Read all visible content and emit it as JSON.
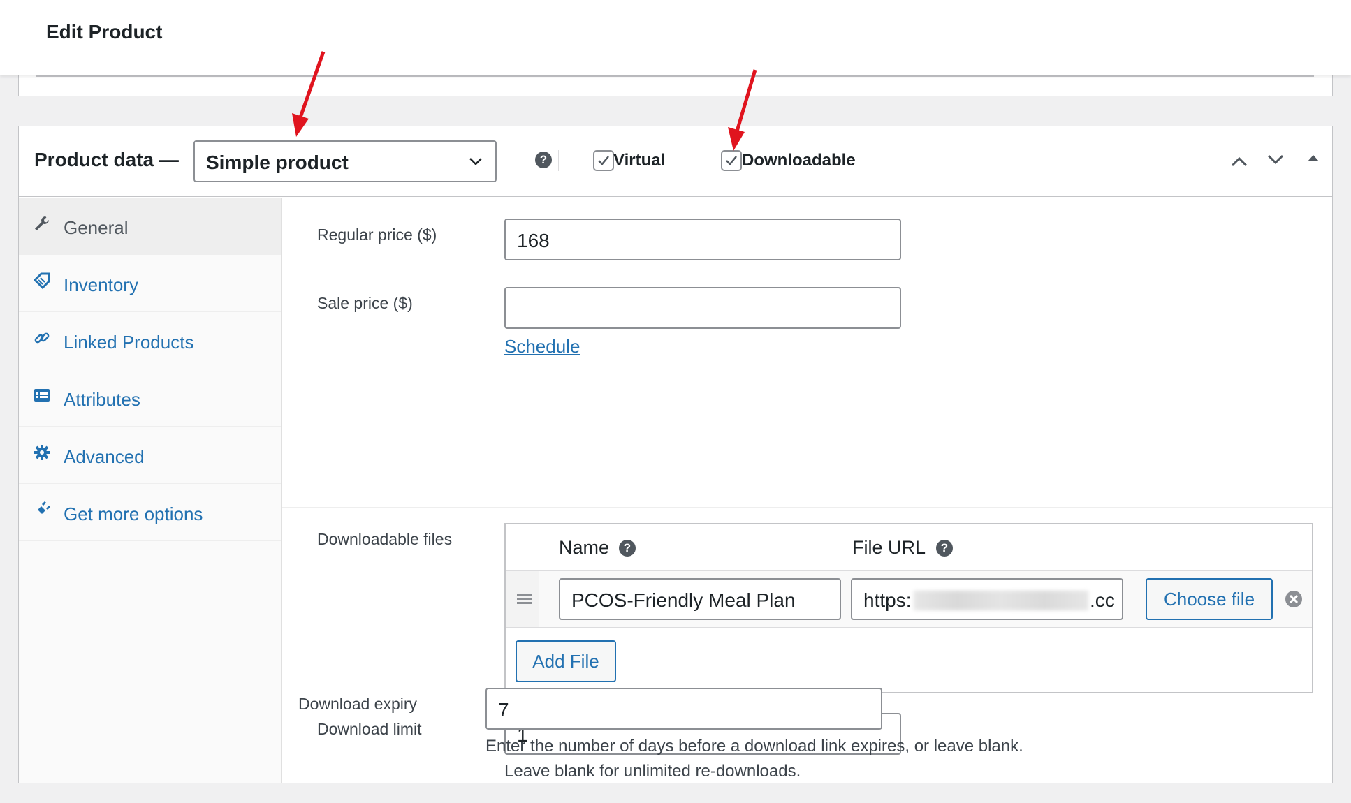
{
  "page": {
    "title": "Edit Product"
  },
  "product_data": {
    "label": "Product data —",
    "type_select": {
      "value": "Simple product"
    },
    "virtual": {
      "label": "Virtual",
      "checked": true
    },
    "downloadable": {
      "label": "Downloadable",
      "checked": true
    }
  },
  "tabs": [
    {
      "label": "General",
      "icon": "wrench-icon",
      "active": true
    },
    {
      "label": "Inventory",
      "icon": "tag-icon"
    },
    {
      "label": "Linked Products",
      "icon": "link-icon"
    },
    {
      "label": "Attributes",
      "icon": "list-icon"
    },
    {
      "label": "Advanced",
      "icon": "gear-icon"
    },
    {
      "label": "Get more options",
      "icon": "plugin-icon"
    }
  ],
  "general": {
    "regular_price": {
      "label": "Regular price ($)",
      "value": "168"
    },
    "sale_price": {
      "label": "Sale price ($)",
      "value": ""
    },
    "schedule_link": "Schedule",
    "downloadable_files": {
      "label": "Downloadable files",
      "col_name": "Name",
      "col_url": "File URL",
      "row": {
        "name": "PCOS-Friendly Meal Plan",
        "url_start": "https:",
        "url_end": ".cc"
      },
      "choose_file": "Choose file",
      "add_file": "Add File"
    },
    "download_limit": {
      "label": "Download limit",
      "value": "1",
      "desc": "Leave blank for unlimited re-downloads."
    },
    "download_expiry": {
      "label": "Download expiry",
      "value": "7",
      "desc": "Enter the number of days before a download link expires, or leave blank."
    }
  },
  "colors": {
    "accent": "#2271b1",
    "annotation": "#e0141e"
  }
}
